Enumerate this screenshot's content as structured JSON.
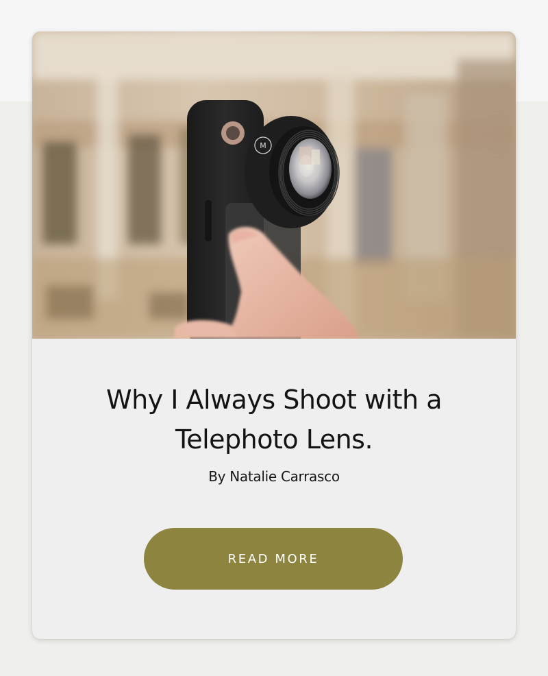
{
  "card": {
    "image_alt": "Hand holding a phone with a telephoto lens attached",
    "lens_badge": "M",
    "title": "Why I Always Shoot with a Telephoto Lens.",
    "byline": "By Natalie Carrasco",
    "cta_label": "READ MORE"
  },
  "colors": {
    "button_bg": "#8c843f",
    "button_text": "#ffffff",
    "card_bg": "#efefef",
    "page_bg": "#efefec",
    "title_text": "#131313"
  }
}
